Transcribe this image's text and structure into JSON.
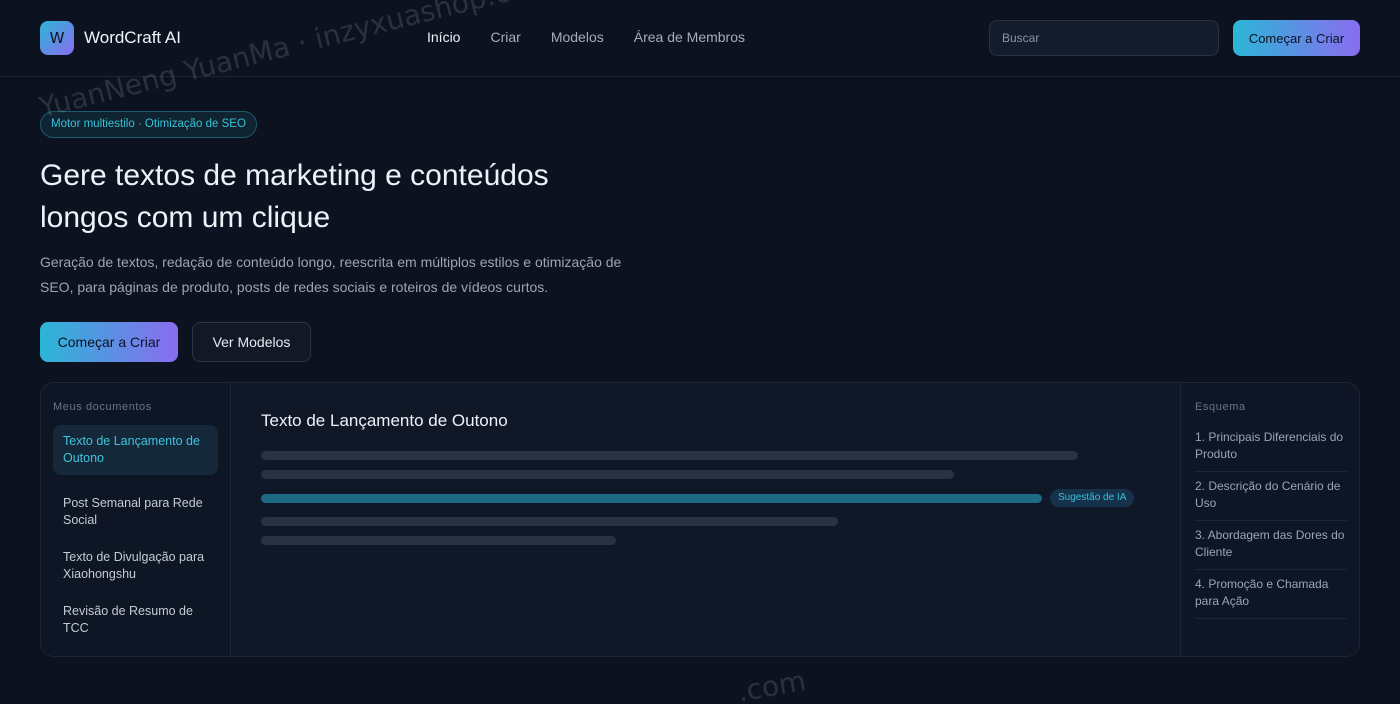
{
  "header": {
    "logo_letter": "W",
    "brand": "WordCraft AI",
    "nav": [
      {
        "label": "Início",
        "active": true
      },
      {
        "label": "Criar",
        "active": false
      },
      {
        "label": "Modelos",
        "active": false
      },
      {
        "label": "Área de Membros",
        "active": false
      }
    ],
    "search_placeholder": "Buscar",
    "cta_label": "Começar a Criar"
  },
  "hero": {
    "badge": "Motor multiestilo · Otimização de SEO",
    "title_line1": "Gere textos de marketing e conteúdos",
    "title_line2": "longos com um clique",
    "subtitle": "Geração de textos, redação de conteúdo longo, reescrita em múltiplos estilos e otimização de SEO, para páginas de produto, posts de redes sociais e roteiros de vídeos curtos.",
    "primary_button": "Começar a Criar",
    "secondary_button": "Ver Modelos"
  },
  "documents": {
    "label": "Meus documentos",
    "items": [
      {
        "label": "Texto de Lançamento de Outono",
        "active": true
      },
      {
        "label": "Post Semanal para Rede Social",
        "active": false
      },
      {
        "label": "Texto de Divulgação para Xiaohongshu",
        "active": false
      },
      {
        "label": "Revisão de Resumo de TCC",
        "active": false
      }
    ]
  },
  "editor": {
    "title": "Texto de Lançamento de Outono",
    "ai_tag": "Sugestão de IA"
  },
  "outline": {
    "label": "Esquema",
    "items": [
      "1. Principais Diferenciais do Produto",
      "2. Descrição do Cenário de Uso",
      "3. Abordagem das Dores do Cliente",
      "4. Promoção e Chamada para Ação"
    ]
  },
  "watermark": {
    "text": "YuanNeng YuanMa · inzyxuashop.com",
    "text_bottom": ".com"
  },
  "colors": {
    "background": "#0c1220",
    "accent_start": "#2bb6d6",
    "accent_end": "#8a6cf0",
    "accent_text": "#36c1d9"
  }
}
